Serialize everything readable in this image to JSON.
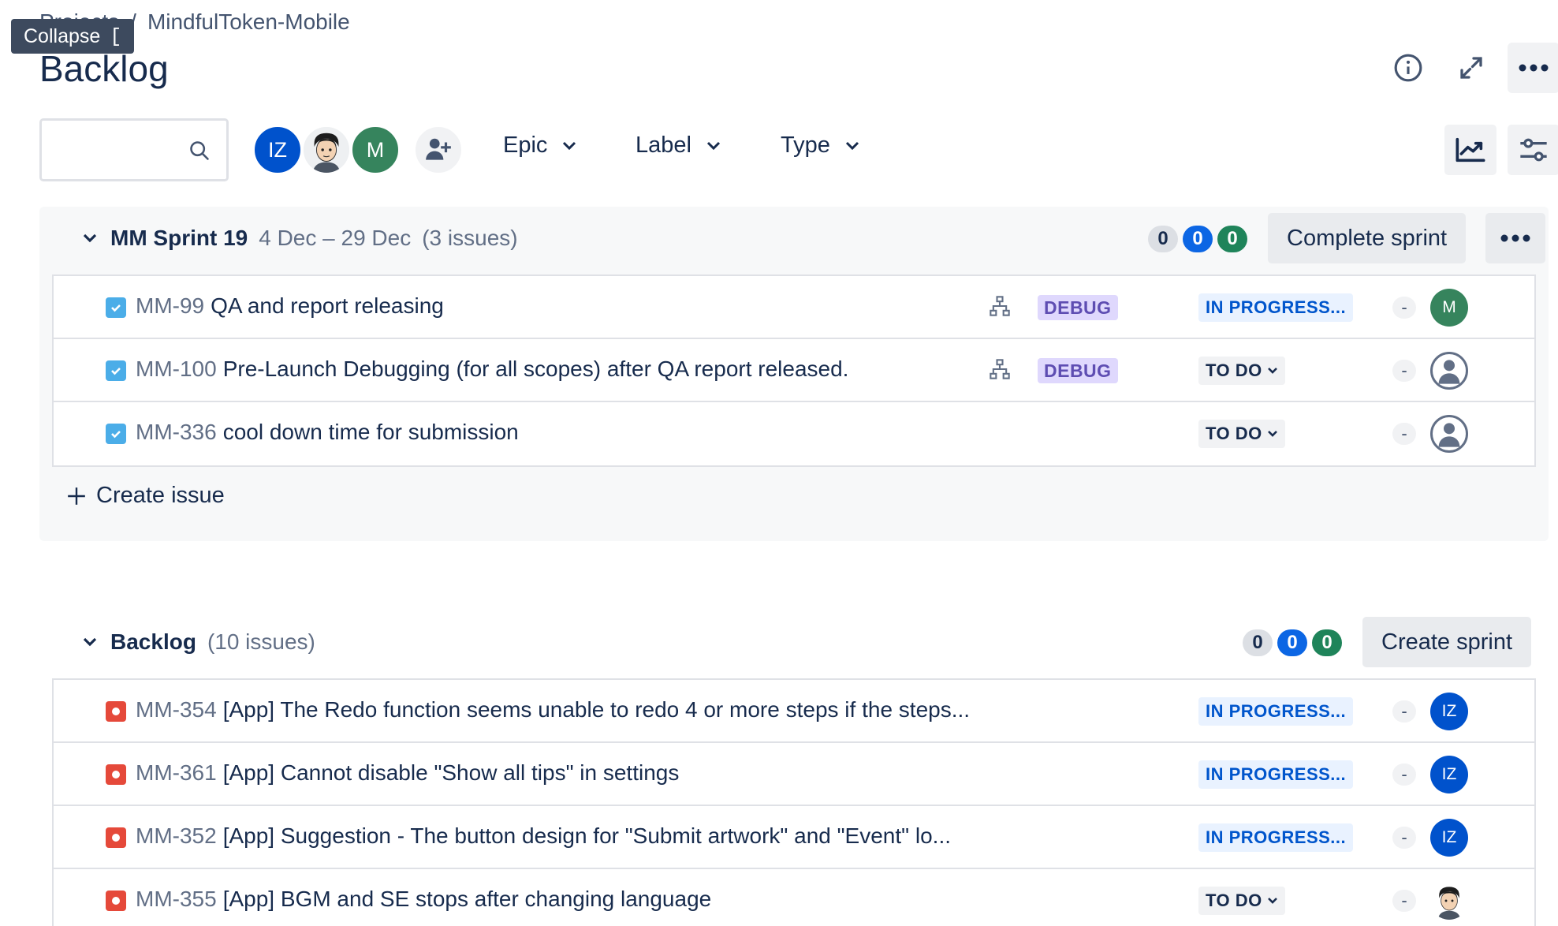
{
  "breadcrumb": {
    "parent": "Projects",
    "separator": "/",
    "project": "MindfulToken-Mobile"
  },
  "tooltip": {
    "label": "Collapse",
    "shortcut": "["
  },
  "page": {
    "title": "Backlog"
  },
  "toolbar": {
    "search_placeholder": "",
    "avatars": [
      {
        "initials": "IZ"
      },
      {
        "initials": ""
      },
      {
        "initials": "M"
      }
    ],
    "filters": [
      {
        "label": "Epic"
      },
      {
        "label": "Label"
      },
      {
        "label": "Type"
      }
    ]
  },
  "sprint": {
    "name": "MM Sprint 19",
    "dates": "4 Dec – 29 Dec",
    "issue_count": "(3 issues)",
    "counts": {
      "todo": "0",
      "in_progress": "0",
      "done": "0"
    },
    "action_label": "Complete sprint",
    "create_issue_label": "Create issue",
    "issues": [
      {
        "key": "MM-99",
        "title": "QA and report releasing",
        "type": "task",
        "epic": "DEBUG",
        "status": "IN PROGRESS...",
        "estimate": "-",
        "assignee": "M"
      },
      {
        "key": "MM-100",
        "title": "Pre-Launch Debugging (for all scopes) after QA report released.",
        "type": "task",
        "epic": "DEBUG",
        "status": "TO DO",
        "estimate": "-",
        "assignee": ""
      },
      {
        "key": "MM-336",
        "title": "cool down time for submission",
        "type": "task",
        "epic": "",
        "status": "TO DO",
        "estimate": "-",
        "assignee": ""
      }
    ]
  },
  "backlog": {
    "name": "Backlog",
    "issue_count": "(10 issues)",
    "counts": {
      "todo": "0",
      "in_progress": "0",
      "done": "0"
    },
    "action_label": "Create sprint",
    "issues": [
      {
        "key": "MM-354",
        "title": "[App] The Redo function seems unable to redo 4 or more steps if the steps...",
        "type": "bug",
        "status": "IN PROGRESS...",
        "estimate": "-",
        "assignee": "IZ"
      },
      {
        "key": "MM-361",
        "title": "[App] Cannot disable \"Show all tips\" in settings",
        "type": "bug",
        "status": "IN PROGRESS...",
        "estimate": "-",
        "assignee": "IZ"
      },
      {
        "key": "MM-352",
        "title": "[App] Suggestion - The button design for \"Submit artwork\" and \"Event\" lo...",
        "type": "bug",
        "status": "IN PROGRESS...",
        "estimate": "-",
        "assignee": "IZ"
      },
      {
        "key": "MM-355",
        "title": "[App] BGM and SE stops after changing language",
        "type": "bug",
        "status": "TO DO",
        "estimate": "-",
        "assignee": ""
      }
    ]
  },
  "colors": {
    "brand_blue": "#0052cc",
    "green": "#36845d",
    "bug_red": "#e5493a",
    "task_blue": "#4bade8",
    "epic_purple": "#5e4db2"
  }
}
